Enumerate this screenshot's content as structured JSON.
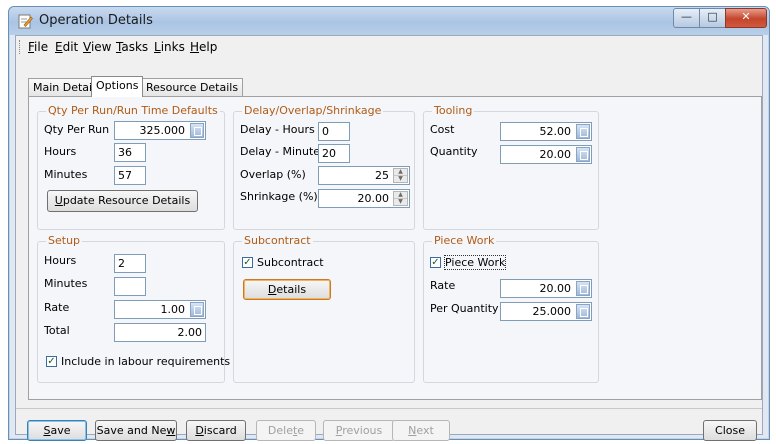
{
  "window": {
    "title": "Operation Details"
  },
  "menu": {
    "file": {
      "pre": "",
      "u": "F",
      "post": "ile"
    },
    "edit": {
      "pre": "",
      "u": "E",
      "post": "dit"
    },
    "view": {
      "pre": "",
      "u": "V",
      "post": "iew"
    },
    "tasks": {
      "pre": "",
      "u": "T",
      "post": "asks"
    },
    "links": {
      "pre": "",
      "u": "L",
      "post": "inks"
    },
    "help": {
      "pre": "",
      "u": "H",
      "post": "elp"
    }
  },
  "tabs": [
    {
      "label": "Main Details"
    },
    {
      "label": "Options"
    },
    {
      "label": "Resource Details"
    }
  ],
  "qty_group": {
    "title": "Qty Per Run/Run Time Defaults",
    "qty_label": "Qty Per Run",
    "qty_value": "325.000",
    "hours_label": "Hours",
    "hours_value": "36",
    "minutes_label": "Minutes",
    "minutes_value": "57",
    "update_btn": {
      "pre": "",
      "u": "U",
      "post": "pdate Resource Details"
    }
  },
  "delay_group": {
    "title": "Delay/Overlap/Shrinkage",
    "delay_hours_label": "Delay - Hours",
    "delay_hours_value": "0",
    "delay_minutes_label": "Delay - Minutes",
    "delay_minutes_value": "20",
    "overlap_label": "Overlap (%)",
    "overlap_value": "25",
    "shrinkage_label": "Shrinkage (%)",
    "shrinkage_value": "20.00"
  },
  "tooling_group": {
    "title": "Tooling",
    "cost_label": "Cost",
    "cost_value": "52.00",
    "quantity_label": "Quantity",
    "quantity_value": "20.00"
  },
  "setup_group": {
    "title": "Setup",
    "hours_label": "Hours",
    "hours_value": "2",
    "minutes_label": "Minutes",
    "minutes_value": "",
    "rate_label": "Rate",
    "rate_value": "1.00",
    "total_label": "Total",
    "total_value": "2.00",
    "include_label": "Include in labour requirements",
    "include_checked": true
  },
  "subcontract_group": {
    "title": "Subcontract",
    "checkbox_label": "Subcontract",
    "checked": true,
    "details_btn": {
      "pre": "",
      "u": "D",
      "post": "etails"
    }
  },
  "piecework_group": {
    "title": "Piece Work",
    "checkbox_label": "Piece Work",
    "checked": true,
    "rate_label": "Rate",
    "rate_value": "20.00",
    "per_qty_label": "Per Quantity",
    "per_qty_value": "25.000"
  },
  "footer": {
    "save": {
      "pre": "",
      "u": "S",
      "post": "ave"
    },
    "save_new": {
      "pre": "Save and Ne",
      "u": "w",
      "post": ""
    },
    "discard": {
      "pre": "",
      "u": "D",
      "post": "iscard"
    },
    "delete": {
      "pre": "Dele",
      "u": "t",
      "post": "e"
    },
    "previous": {
      "pre": "",
      "u": "P",
      "post": "revious"
    },
    "next": {
      "pre": "",
      "u": "N",
      "post": "ext"
    },
    "close": {
      "pre": "Close",
      "u": "",
      "post": ""
    }
  }
}
